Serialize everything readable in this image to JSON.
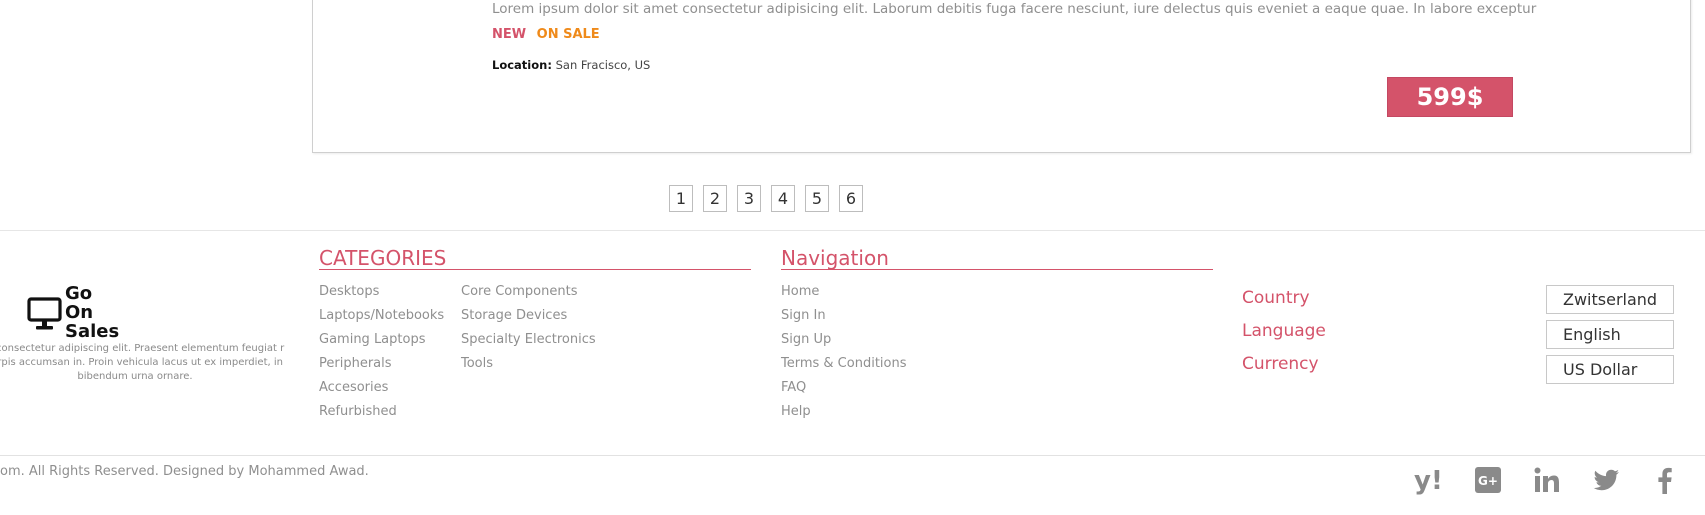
{
  "product": {
    "description": "Lorem ipsum dolor sit amet consectetur adipisicing elit. Laborum debitis fuga facere nesciunt, iure delectus quis eveniet a eaque quae. In labore exceptur",
    "tag_new": "NEW",
    "tag_sale": "ON SALE",
    "location_label": "Location:",
    "location_value": "San Fracisco, US",
    "price": "599$"
  },
  "pagination": {
    "pages": [
      "1",
      "2",
      "3",
      "4",
      "5",
      "6"
    ]
  },
  "brand": {
    "icon": "desktop-monitor-icon",
    "name_lines": [
      "Go",
      "On",
      "Sales"
    ],
    "text": "t, consectetur adipiscing elit. Praesent elementum feugiat r turpis accumsan in. Proin vehicula lacus ut ex imperdiet, in bibendum urna ornare."
  },
  "categories": {
    "title": "CATEGORIES",
    "col1": [
      "Desktops",
      "Laptops/Notebooks",
      "Gaming Laptops",
      "Peripherals",
      "Accesories",
      "Refurbished"
    ],
    "col2": [
      "Core Components",
      "Storage Devices",
      "Specialty Electronics",
      "Tools"
    ]
  },
  "navigation": {
    "title": "Navigation",
    "items": [
      "Home",
      "Sign In",
      "Sign Up",
      "Terms & Conditions",
      "FAQ",
      "Help"
    ]
  },
  "options": {
    "country_label": "Country",
    "language_label": "Language",
    "currency_label": "Currency",
    "country_value": "Zwitserland",
    "language_value": "English",
    "currency_value": "US Dollar"
  },
  "copyright": "om. All Rights Reserved. Designed by Mohammed Awad.",
  "social": [
    "yahoo-icon",
    "google-plus-icon",
    "linkedin-icon",
    "twitter-icon",
    "facebook-icon"
  ],
  "colors": {
    "accent": "#d4536a",
    "sale": "#ef8a1a",
    "muted_text": "#8f8f8f",
    "icon_gray": "#8a8a8a"
  }
}
